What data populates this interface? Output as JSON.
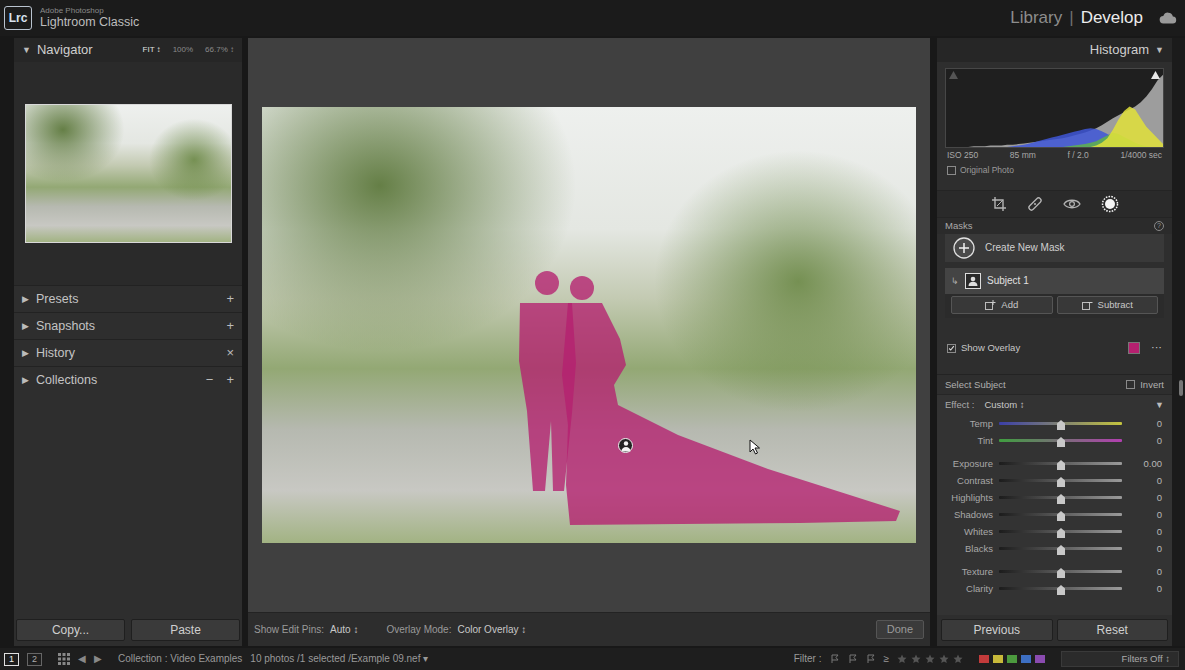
{
  "app": {
    "logo": "Lrc",
    "vendor": "Adobe Photoshop",
    "product": "Lightroom Classic"
  },
  "modules": [
    {
      "label": "Library",
      "selected": false
    },
    {
      "label": "Develop",
      "selected": true
    }
  ],
  "module_separator": "|",
  "navigator": {
    "toggle": "▼",
    "title": "Navigator",
    "zoom": [
      {
        "label": "FIT ↕",
        "selected": true
      },
      {
        "label": "100%",
        "selected": false
      },
      {
        "label": "66.7% ↕",
        "selected": false
      }
    ]
  },
  "left_panels": [
    {
      "toggle": "▶",
      "title": "Presets",
      "actions": [
        "+"
      ]
    },
    {
      "toggle": "▶",
      "title": "Snapshots",
      "actions": [
        "+"
      ]
    },
    {
      "toggle": "▶",
      "title": "History",
      "actions": [
        "×"
      ]
    },
    {
      "toggle": "▶",
      "title": "Collections",
      "actions": [
        "−",
        "+"
      ]
    }
  ],
  "left_buttons": [
    "Copy...",
    "Paste"
  ],
  "toolbar": {
    "edit_pins_label": "Show Edit Pins:",
    "edit_pins_value": "Auto ↕",
    "overlay_label": "Overlay Mode:",
    "overlay_value": "Color Overlay ↕",
    "done": "Done"
  },
  "histogram": {
    "title": "Histogram",
    "toggle": "▼",
    "series": [
      {
        "values": [
          0,
          0,
          0,
          0,
          0,
          1,
          1,
          1,
          2,
          2,
          2,
          3,
          3,
          4,
          5,
          6,
          7,
          8,
          9,
          10,
          11,
          12,
          14,
          16,
          18,
          20,
          23,
          26,
          30,
          35,
          40,
          44,
          48,
          52,
          56,
          62,
          70,
          80,
          92,
          100
        ],
        "color": "#bdbdbd"
      },
      {
        "values": [
          0,
          0,
          0,
          0,
          0,
          0,
          0,
          0,
          0,
          0,
          0,
          0,
          1,
          2,
          3,
          5,
          7,
          9,
          11,
          13,
          15,
          17,
          19,
          21,
          23,
          25,
          26,
          25,
          22,
          18,
          14,
          10,
          7,
          4,
          2,
          1,
          0,
          0,
          0,
          0
        ],
        "color": "#3f57d8"
      },
      {
        "values": [
          0,
          0,
          0,
          0,
          0,
          0,
          0,
          0,
          0,
          0,
          0,
          0,
          0,
          0,
          0,
          0,
          0,
          0,
          0,
          0,
          0,
          0,
          1,
          2,
          3,
          4,
          6,
          8,
          12,
          16,
          20,
          18,
          14,
          10,
          6,
          3,
          1,
          0,
          0,
          0
        ],
        "color": "#5fb34a"
      },
      {
        "values": [
          0,
          0,
          0,
          0,
          0,
          0,
          0,
          0,
          0,
          0,
          0,
          0,
          0,
          0,
          0,
          0,
          0,
          0,
          0,
          0,
          0,
          0,
          0,
          0,
          0,
          0,
          0,
          2,
          6,
          12,
          24,
          38,
          50,
          56,
          52,
          40,
          28,
          20,
          12,
          4
        ],
        "color": "#e2e23a"
      }
    ],
    "info": [
      "ISO 250",
      "85 mm",
      "f / 2.0",
      "1/4000 sec"
    ],
    "original_photo": {
      "label": "Original Photo",
      "checked": false
    }
  },
  "tools": [
    {
      "kind": "crop",
      "selected": false
    },
    {
      "kind": "heal",
      "selected": false
    },
    {
      "kind": "redeye",
      "selected": false
    },
    {
      "kind": "mask",
      "selected": true
    }
  ],
  "masks": {
    "title": "Masks",
    "help": "?",
    "create": "Create New Mask",
    "items": [
      {
        "arrow": "↳",
        "label": "Subject 1",
        "selected": true
      }
    ],
    "add": "Add",
    "subtract": "Subtract",
    "show_overlay": {
      "label": "Show Overlay",
      "checked": true,
      "color": "#b5206f"
    },
    "more": "···"
  },
  "selection": {
    "label": "Select Subject",
    "invert": {
      "label": "Invert",
      "checked": false
    }
  },
  "effect": {
    "label": "Effect :",
    "value": "Custom ↕",
    "toggle": "▼",
    "slider_groups": [
      [
        {
          "label": "Temp",
          "value": "0",
          "level": 0.5,
          "colors": [
            "#3b3fa8",
            "#c4c43e"
          ]
        },
        {
          "label": "Tint",
          "value": "0",
          "level": 0.5,
          "colors": [
            "#3f9e3f",
            "#b23fb0"
          ]
        }
      ],
      [
        {
          "label": "Exposure",
          "value": "0.00",
          "level": 0.5,
          "colors": [
            "#1c1c1c",
            "#9a9a9a"
          ]
        },
        {
          "label": "Contrast",
          "value": "0",
          "level": 0.5,
          "colors": [
            "#1c1c1c",
            "#9a9a9a"
          ]
        },
        {
          "label": "Highlights",
          "value": "0",
          "level": 0.5,
          "colors": [
            "#1c1c1c",
            "#9a9a9a"
          ]
        },
        {
          "label": "Shadows",
          "value": "0",
          "level": 0.5,
          "colors": [
            "#1c1c1c",
            "#9a9a9a"
          ]
        },
        {
          "label": "Whites",
          "value": "0",
          "level": 0.5,
          "colors": [
            "#1c1c1c",
            "#9a9a9a"
          ]
        },
        {
          "label": "Blacks",
          "value": "0",
          "level": 0.5,
          "colors": [
            "#1c1c1c",
            "#9a9a9a"
          ]
        }
      ],
      [
        {
          "label": "Texture",
          "value": "0",
          "level": 0.5,
          "colors": [
            "#1c1c1c",
            "#9a9a9a"
          ]
        },
        {
          "label": "Clarity",
          "value": "0",
          "level": 0.5,
          "colors": [
            "#1c1c1c",
            "#9a9a9a"
          ]
        }
      ]
    ]
  },
  "right_buttons": [
    "Previous",
    "Reset"
  ],
  "filmstrip": {
    "screens": [
      {
        "label": "1",
        "selected": true
      },
      {
        "label": "2",
        "selected": false
      }
    ],
    "nav": [
      "◀",
      "▶"
    ],
    "source": "Collection : Video Examples",
    "count": "10 photos /1 selected /Example 09.nef ▾",
    "filter_label": "Filter :",
    "rating_op": "≥",
    "stars": 0,
    "color_labels": [
      {
        "color": "#c23b3b"
      },
      {
        "color": "#c7b93a"
      },
      {
        "color": "#4c9a3e"
      },
      {
        "color": "#3d6fc2"
      },
      {
        "color": "#8a4bb0"
      }
    ],
    "filter_value": "Filters Off ↕"
  }
}
